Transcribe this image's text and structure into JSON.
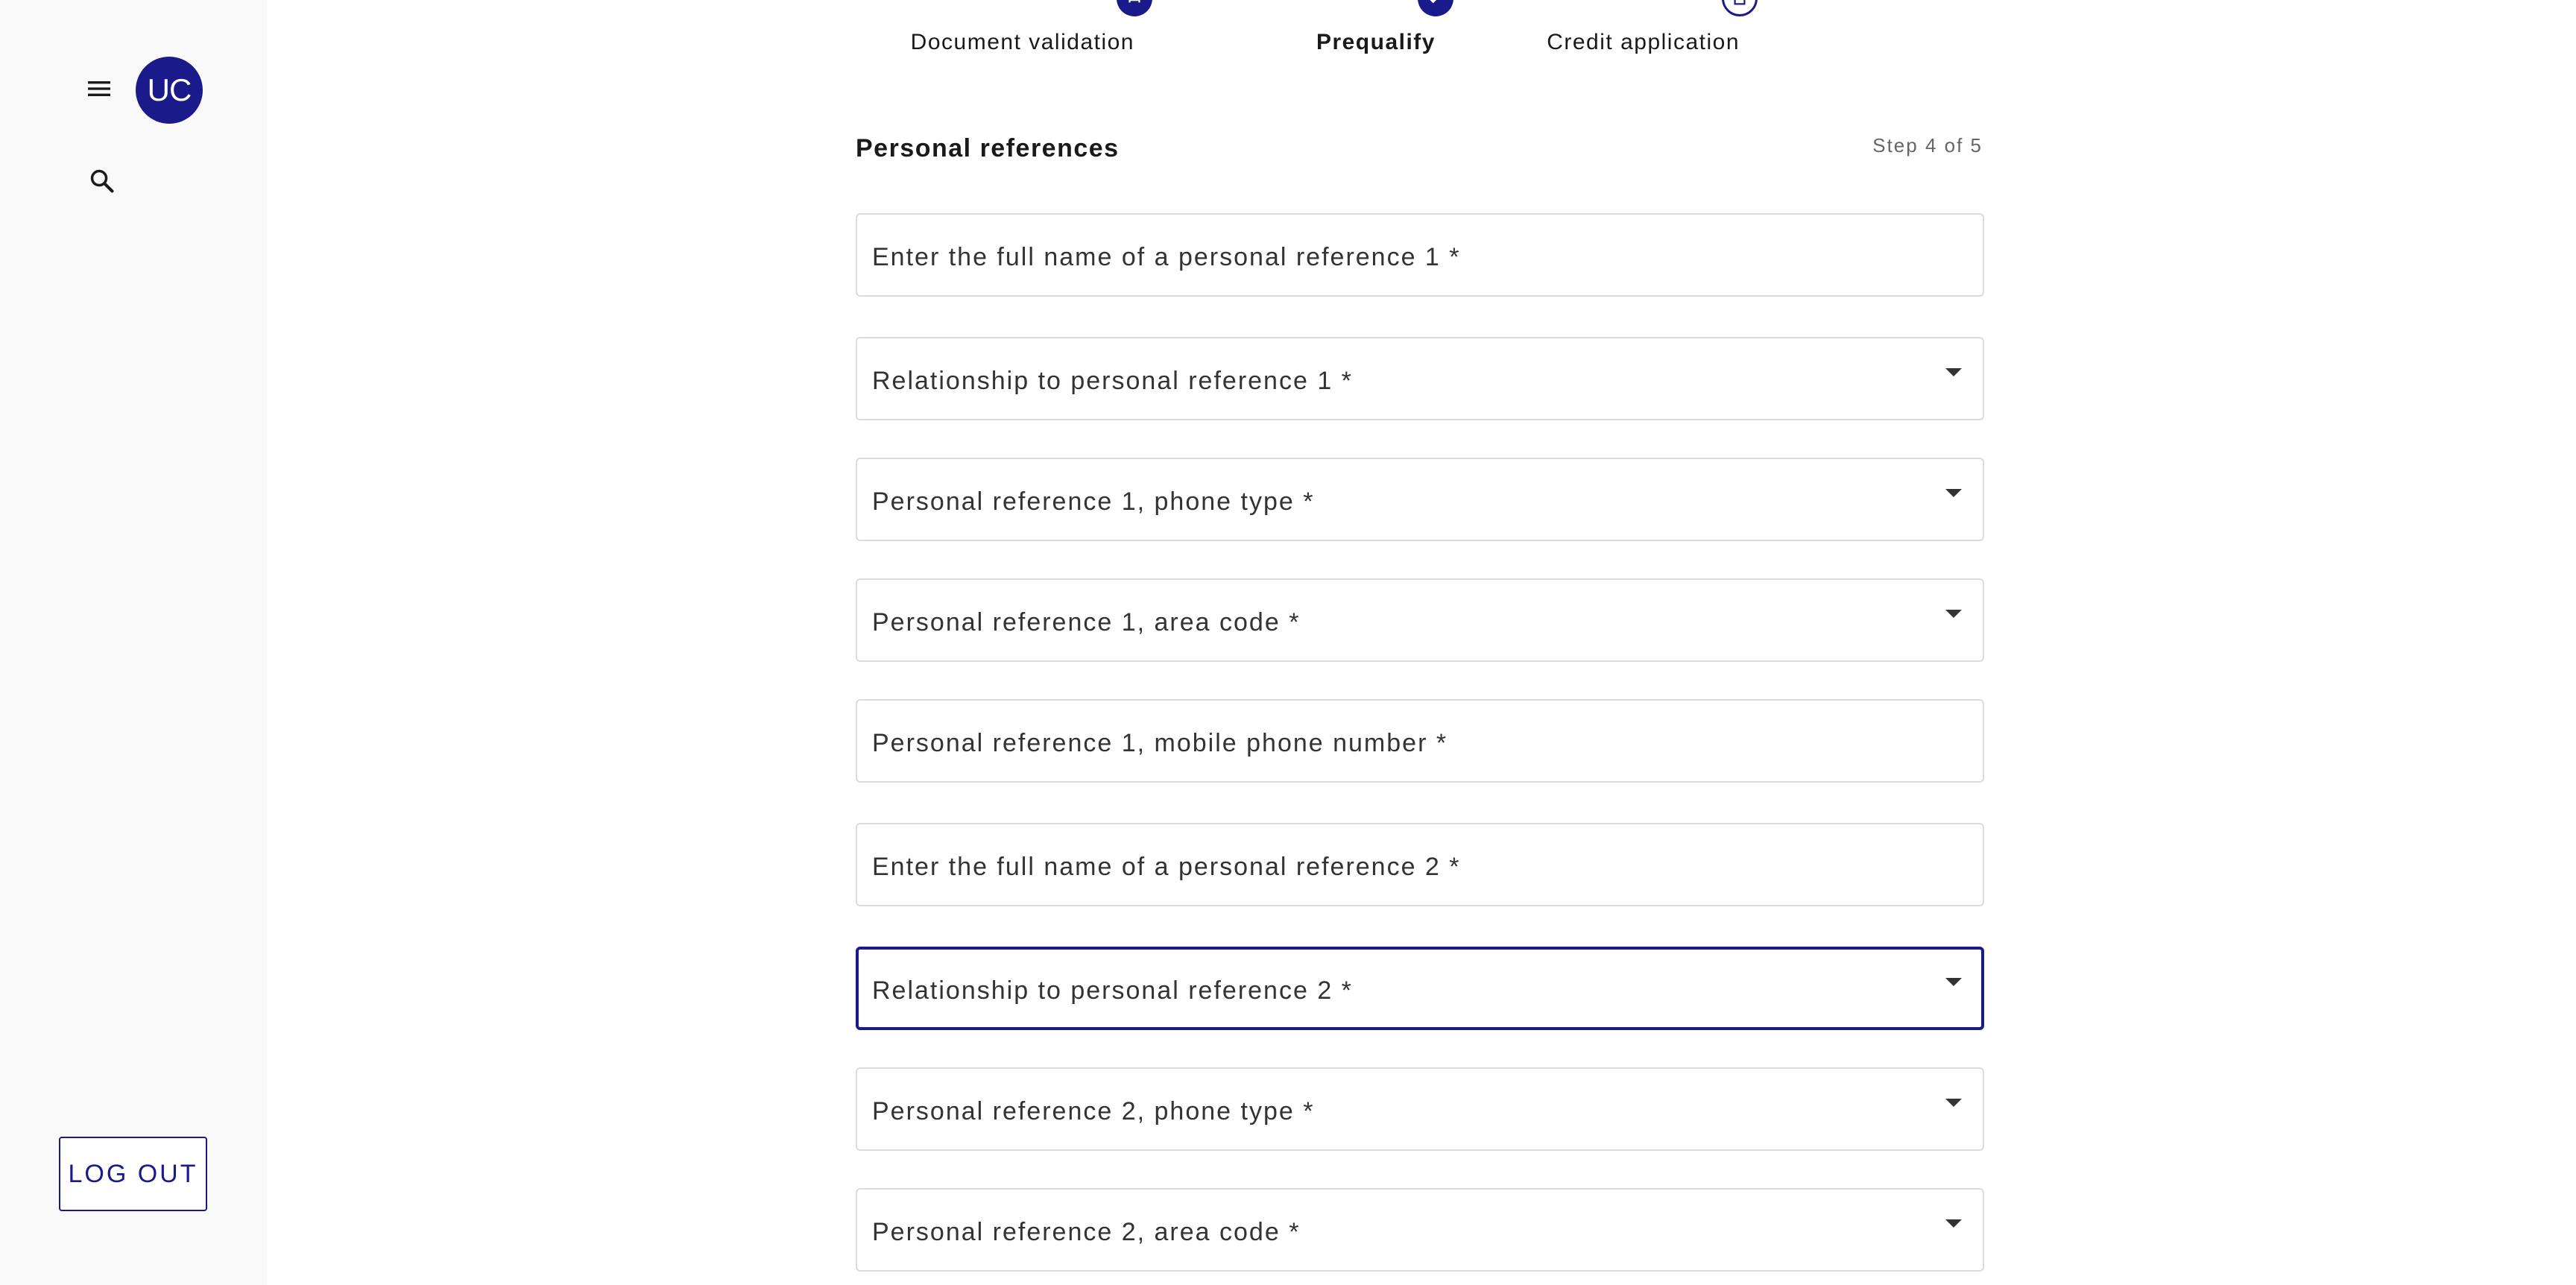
{
  "sidebar": {
    "avatar_initials": "UC",
    "logout_label": "LOG OUT",
    "menu_icon": "menu-icon",
    "search_icon": "search-icon"
  },
  "stepper": {
    "steps": [
      {
        "label": "Document validation",
        "icon": "car-icon",
        "state": "completed"
      },
      {
        "label": "Prequalify",
        "icon": "checklist-icon",
        "state": "active"
      },
      {
        "label": "Credit application",
        "icon": "document-icon",
        "state": "upcoming"
      }
    ]
  },
  "form": {
    "section_title": "Personal references",
    "step_counter": "Step 4 of 5",
    "fields": [
      {
        "label": "Enter the full name of a personal reference 1 *",
        "type": "text"
      },
      {
        "label": "Relationship to personal reference 1 *",
        "type": "select"
      },
      {
        "label": "Personal reference 1, phone type *",
        "type": "select"
      },
      {
        "label": "Personal reference 1, area code *",
        "type": "select"
      },
      {
        "label": "Personal reference 1, mobile phone number *",
        "type": "text"
      },
      {
        "label": "Enter the full name of a personal reference 2 *",
        "type": "text"
      },
      {
        "label": "Relationship to personal reference 2 *",
        "type": "select",
        "focused": true
      },
      {
        "label": "Personal reference 2, phone type *",
        "type": "select"
      },
      {
        "label": "Personal reference 2, area code *",
        "type": "select"
      }
    ]
  },
  "colors": {
    "accent": "#1a1a8a",
    "sidebar_bg": "#f9f9f9",
    "field_border": "#dcdcdc"
  }
}
